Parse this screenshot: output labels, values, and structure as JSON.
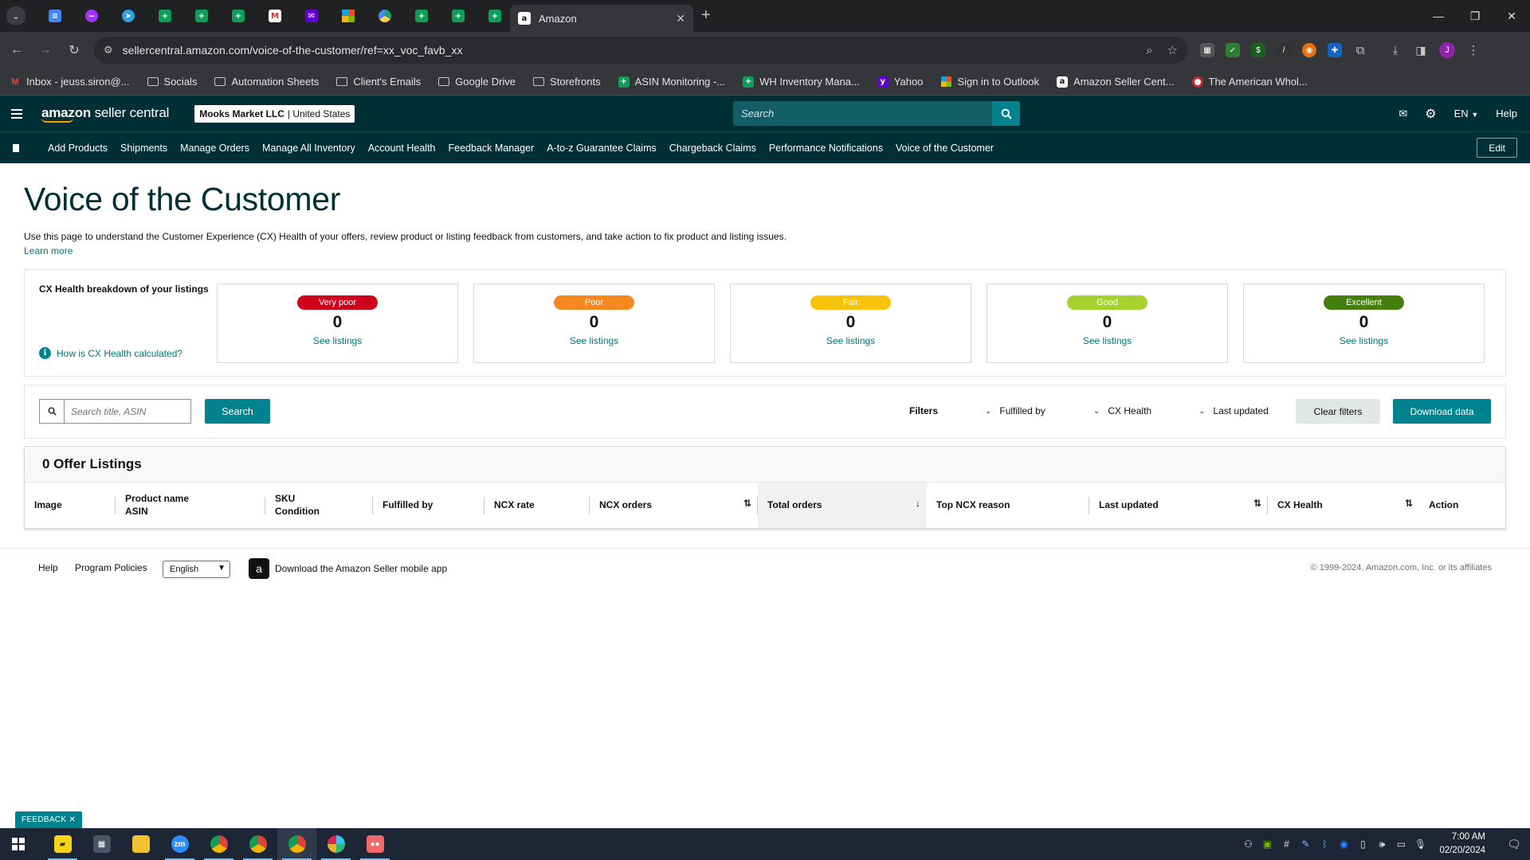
{
  "browser": {
    "active_tab_title": "Amazon",
    "url": "sellercentral.amazon.com/voice-of-the-customer/ref=xx_voc_favb_xx",
    "pinned_tabs": [
      "docs-icon",
      "messenger-icon",
      "telegram-icon",
      "sheets-icon",
      "sheets-icon",
      "sheets-icon",
      "gmail-icon",
      "yahoo-mail-icon",
      "microsoft-icon",
      "google-drive-icon",
      "sheets-icon",
      "sheets-icon",
      "sheets-icon"
    ],
    "bookmarks": [
      {
        "label": "Inbox - jeuss.siron@...",
        "icon": "gmail-icon"
      },
      {
        "label": "Socials",
        "icon": "folder-icon"
      },
      {
        "label": "Automation Sheets",
        "icon": "folder-icon"
      },
      {
        "label": "Client's Emails",
        "icon": "folder-icon"
      },
      {
        "label": "Google Drive",
        "icon": "folder-icon"
      },
      {
        "label": "Storefronts",
        "icon": "folder-icon"
      },
      {
        "label": "ASIN Monitoring -...",
        "icon": "sheets-icon"
      },
      {
        "label": "WH Inventory Mana...",
        "icon": "sheets-icon"
      },
      {
        "label": "Yahoo",
        "icon": "yahoo-icon"
      },
      {
        "label": "Sign in to Outlook",
        "icon": "microsoft-icon"
      },
      {
        "label": "Amazon Seller Cent...",
        "icon": "amazon-icon"
      },
      {
        "label": "The American Whol...",
        "icon": "globe-icon"
      }
    ],
    "profile_initial": "J"
  },
  "header": {
    "logo_prefix": "amazon",
    "logo_suffix": " seller central",
    "account_name": "Mooks Market LLC",
    "account_region": "United States",
    "search_placeholder": "Search",
    "language": "EN",
    "help": "Help"
  },
  "nav": {
    "links": [
      "Add Products",
      "Shipments",
      "Manage Orders",
      "Manage All Inventory",
      "Account Health",
      "Feedback Manager",
      "A-to-z Guarantee Claims",
      "Chargeback Claims",
      "Performance Notifications",
      "Voice of the Customer"
    ],
    "edit": "Edit"
  },
  "page": {
    "title": "Voice of the Customer",
    "description": "Use this page to understand the Customer Experience (CX) Health of your offers, review product or listing feedback from customers, and take action to fix product and listing issues.",
    "learn_more": "Learn more"
  },
  "cx_health": {
    "heading": "CX Health breakdown of your listings",
    "how_link": "How is CX Health calculated?",
    "tiles": [
      {
        "label": "Very poor",
        "count": "0",
        "link": "See listings",
        "color": "#d0021b"
      },
      {
        "label": "Poor",
        "count": "0",
        "link": "See listings",
        "color": "#f5891f"
      },
      {
        "label": "Fair",
        "count": "0",
        "link": "See listings",
        "color": "#f8c40b"
      },
      {
        "label": "Good",
        "count": "0",
        "link": "See listings",
        "color": "#a5d22f"
      },
      {
        "label": "Excellent",
        "count": "0",
        "link": "See listings",
        "color": "#457f0d"
      }
    ]
  },
  "filters": {
    "search_placeholder": "Search title, ASIN",
    "search_button": "Search",
    "filters_label": "Filters",
    "fulfilled_by": "Fulfilled by",
    "cx_health": "CX Health",
    "last_updated": "Last updated",
    "clear": "Clear filters",
    "download": "Download data"
  },
  "listings": {
    "heading": "0 Offer Listings",
    "columns": [
      {
        "line1": "Image",
        "line2": ""
      },
      {
        "line1": "Product name",
        "line2": "ASIN"
      },
      {
        "line1": "SKU",
        "line2": "Condition"
      },
      {
        "line1": "Fulfilled by",
        "line2": ""
      },
      {
        "line1": "NCX rate",
        "line2": ""
      },
      {
        "line1": "NCX orders",
        "line2": ""
      },
      {
        "line1": "Total orders",
        "line2": ""
      },
      {
        "line1": "Top NCX reason",
        "line2": ""
      },
      {
        "line1": "Last updated",
        "line2": ""
      },
      {
        "line1": "CX Health",
        "line2": ""
      },
      {
        "line1": "Action",
        "line2": ""
      }
    ]
  },
  "footer": {
    "help": "Help",
    "policies": "Program Policies",
    "language": "English",
    "app_link": "Download the Amazon Seller mobile app",
    "copyright": "© 1999-2024, Amazon.com, Inc. or its affiliates",
    "feedback": "FEEDBACK"
  },
  "taskbar": {
    "time": "7:00 AM",
    "date": "02/20/2024"
  }
}
